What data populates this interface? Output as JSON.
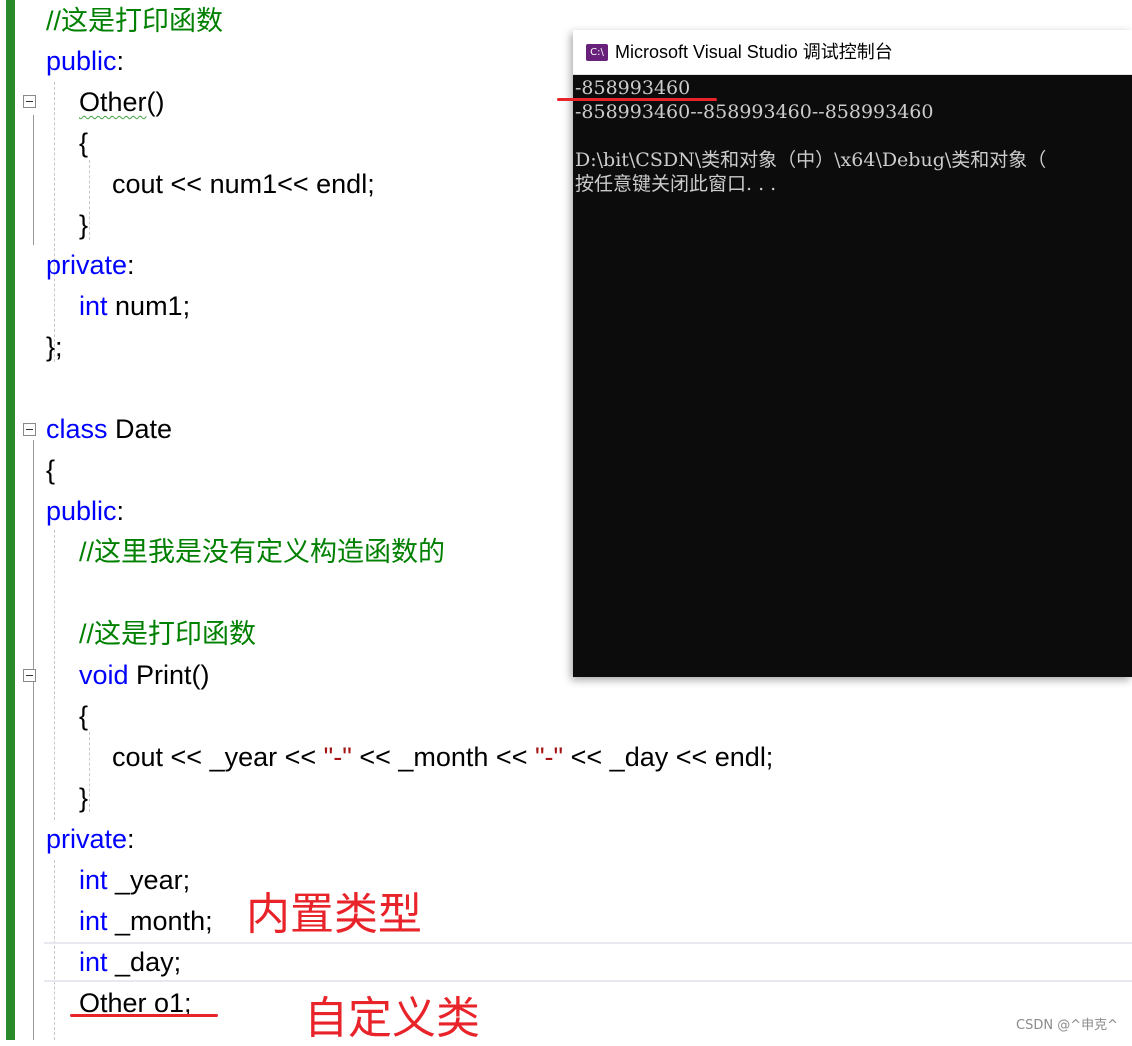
{
  "editor": {
    "l1_comment": "//这是打印函数",
    "l2_public": "public",
    "l3_other": "Other",
    "l3_parens": "()",
    "l4_brace": "{",
    "l5_cout": "cout << num1<< endl;",
    "l6_brace": "}",
    "l7_private": "private",
    "l8_int": "int",
    "l8_rest": " num1;",
    "l9_end": "};",
    "l10_class": "class",
    "l10_name": " Date",
    "l11_brace": "{",
    "l12_public": "public",
    "l13_comment": "//这里我是没有定义构造函数的",
    "l14_comment": "//这是打印函数",
    "l15_void": "void",
    "l15_rest": " Print()",
    "l16_brace": "{",
    "l17_a": "cout << _year << ",
    "l17_s1": "\"-\"",
    "l17_b": " << _month << ",
    "l17_s2": "\"-\"",
    "l17_c": " << _day << endl;",
    "l18_brace": "}",
    "l19_private": "private",
    "l20_int": "int",
    "l20_rest": " _year;",
    "l21_int": "int",
    "l21_rest": " _month;",
    "l22_int": "int",
    "l22_rest": " _day;",
    "l23_text": "Other o1;",
    "colon": ":"
  },
  "annotations": {
    "builtin_types": "内置类型",
    "custom_class": "自定义类",
    "color": "#e8232a"
  },
  "console": {
    "title": "Microsoft Visual Studio 调试控制台",
    "icon_text": "C:\\",
    "line1": "-858993460",
    "line2": "-858993460--858993460--858993460",
    "line3": "D:\\bit\\CSDN\\类和对象（中）\\x64\\Debug\\类和对象（",
    "line4": "按任意键关闭此窗口. . ."
  },
  "watermark": "CSDN @^申克^",
  "colors": {
    "keyword": "#0000ff",
    "comment": "#008000",
    "string": "#a31515",
    "changebar": "#2a8a2a",
    "console_bg": "#0c0c0c"
  }
}
